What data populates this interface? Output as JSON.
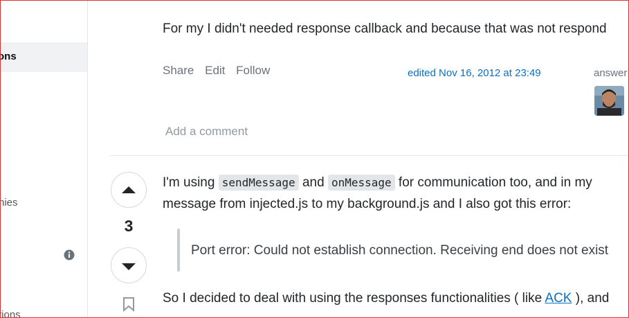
{
  "sidebar": {
    "active_label": "ons",
    "companies_label": "nies",
    "collectives_label": "tions"
  },
  "answer1": {
    "text_line": "For my I didn't needed response callback and because that was not respond",
    "menu": {
      "share": "Share",
      "edit": "Edit",
      "follow": "Follow"
    },
    "edited": "edited Nov 16, 2012 at 23:49",
    "answered": "answer",
    "add_comment": "Add a comment"
  },
  "answer2": {
    "vote_count": "3",
    "p1": {
      "a": "I'm using ",
      "code1": "sendMessage",
      "b": " and ",
      "code2": "onMessage",
      "c": " for communication too, and in my"
    },
    "p1_line2": "message from injected.js to my background.js and I also got this error:",
    "quote": "Port error: Could not establish connection. Receiving end does not exist",
    "p2": {
      "a": "So I decided to deal with using the responses functionalities ( like ",
      "link": "ACK",
      "b": " ), and"
    }
  },
  "colors": {
    "link": "#0a70c4",
    "border_red": "#e0302e",
    "nav_active_bg": "#f1f2f3"
  },
  "icons": [
    "info-icon",
    "arrow-up-icon",
    "arrow-down-icon",
    "bookmark-icon",
    "avatar"
  ]
}
